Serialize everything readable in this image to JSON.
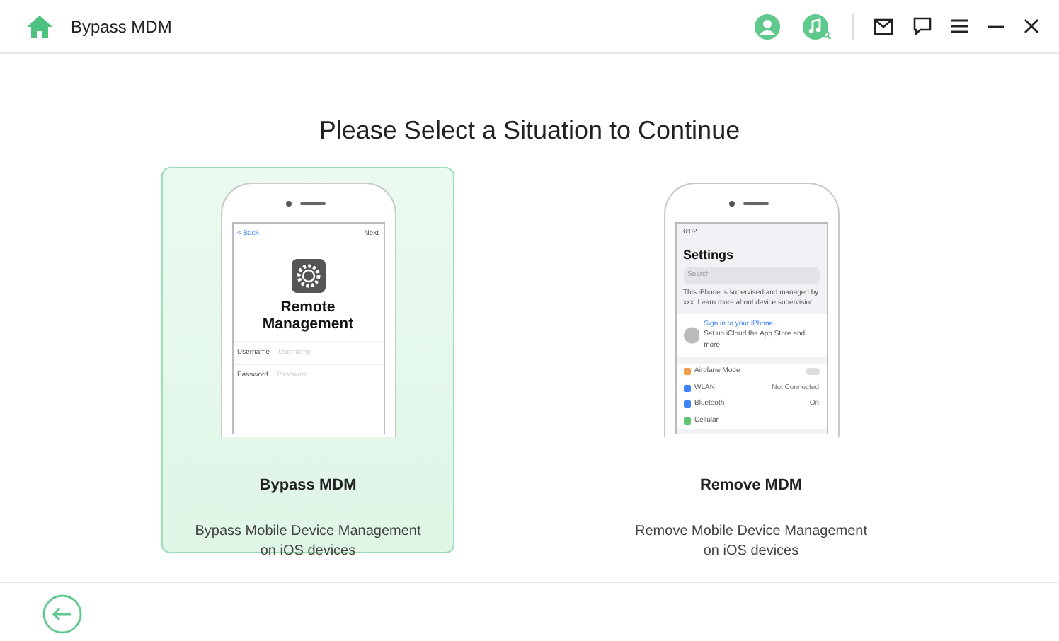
{
  "window": {
    "title": "Bypass MDM"
  },
  "heading": "Please Select a Situation to Continue",
  "options": [
    {
      "kind": "remote",
      "selected": true,
      "title": "Bypass MDM",
      "description": "Bypass Mobile Device Management on iOS devices",
      "screen": {
        "back": "< Back",
        "next": "Next",
        "heading": "Remote Management",
        "fields": [
          {
            "label": "Username",
            "placeholder": "Username"
          },
          {
            "label": "Password",
            "placeholder": "Password"
          }
        ]
      }
    },
    {
      "kind": "settings",
      "selected": false,
      "title": "Remove MDM",
      "description": "Remove Mobile Device Management on iOS devices",
      "screen": {
        "time": "6:02",
        "heading": "Settings",
        "search": "Search",
        "notice": "This iPhone is supervised and managed by xxx. Learn more about device supervision.",
        "account_title": "Sign in to your iPhone",
        "account_subtitle": "Set up iCloud the App Store and more",
        "rows": [
          {
            "label": "Airplane Mode",
            "kind": "toggle",
            "on": false,
            "color": "#f0a04b"
          },
          {
            "label": "WLAN",
            "kind": "text",
            "value": "Not Connected",
            "color": "#3d82f6"
          },
          {
            "label": "Bluetooth",
            "kind": "text",
            "value": "On",
            "color": "#3d82f6"
          },
          {
            "label": "Cellular",
            "kind": "text",
            "color": "#5cc46a"
          }
        ]
      }
    }
  ]
}
